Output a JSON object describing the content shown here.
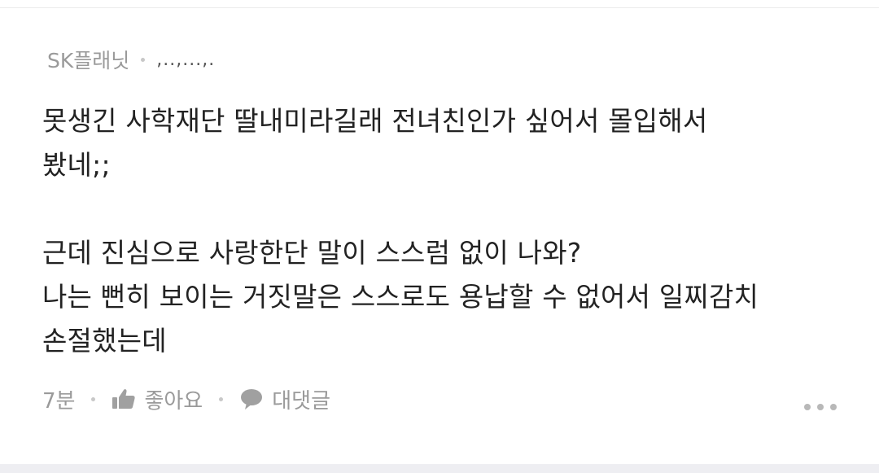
{
  "comment": {
    "author": "SK플래닛",
    "nickname": ",..,...,.",
    "text": "못생긴 사학재단 딸내미라길래 전녀친인가 싶어서 몰입해서\n봤네;;\n\n근데 진심으로 사랑한단 말이 스스럼 없이 나와?\n나는 뻔히 보이는 거짓말은 스스로도 용납할 수 없어서 일찌감치\n손절했는데",
    "time": "7분",
    "like_label": "좋아요",
    "reply_label": "대댓글",
    "icons": {
      "like": "thumbs-up-icon",
      "reply": "speech-bubble-icon",
      "more": "more-dots-icon"
    }
  },
  "colors": {
    "meta_text": "#9a9a9a",
    "body_text": "#222222",
    "icon": "#a0a0a0",
    "bottom_bar": "#eeeef2"
  }
}
